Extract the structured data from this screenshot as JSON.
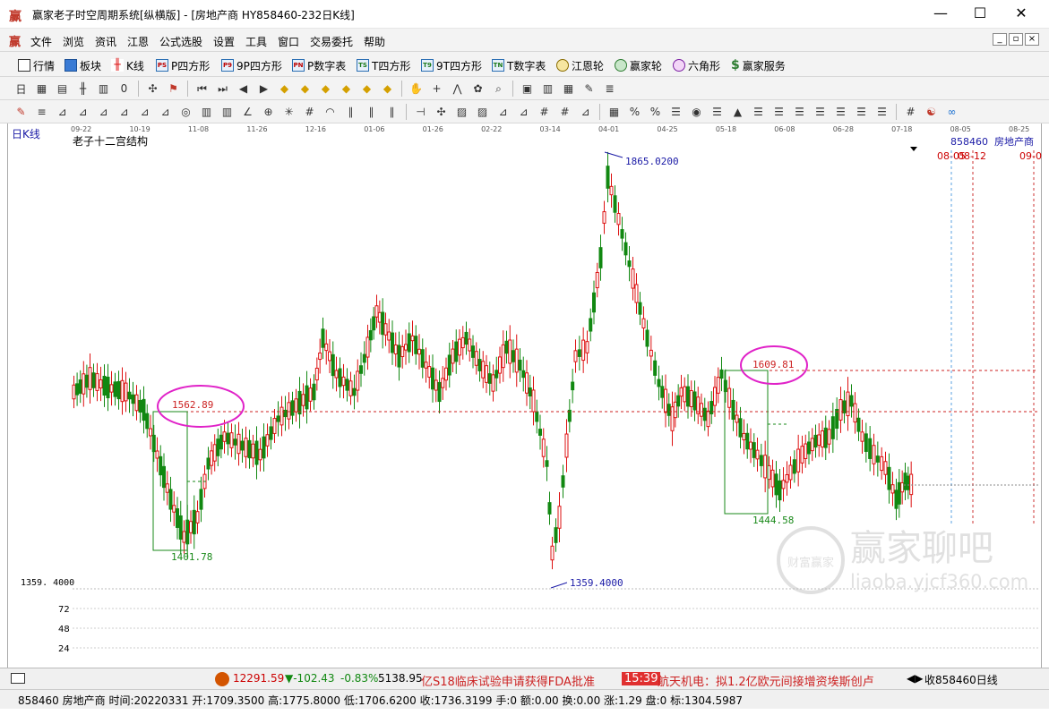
{
  "window": {
    "icon": "赢",
    "title": "赢家老子时空周期系统[纵横版] - [房地产商  HY858460-232日K线]",
    "minimize": "—",
    "maximize": "☐",
    "close": "✕"
  },
  "menu": {
    "items": [
      "文件",
      "浏览",
      "资讯",
      "江恩",
      "公式选股",
      "设置",
      "工具",
      "窗口",
      "交易委托",
      "帮助"
    ],
    "mdi": [
      "_",
      "▫",
      "×"
    ]
  },
  "toolbar1": {
    "items": [
      {
        "label": "行情",
        "icon": "grid-icon"
      },
      {
        "label": "板块",
        "icon": "blocks-icon"
      },
      {
        "label": "K线",
        "icon": "candles-icon"
      },
      {
        "label": "P四方形",
        "icon": "PS"
      },
      {
        "label": "9P四方形",
        "icon": "P9"
      },
      {
        "label": "P数字表",
        "icon": "PN"
      },
      {
        "label": "T四方形",
        "icon": "TS"
      },
      {
        "label": "9T四方形",
        "icon": "T9"
      },
      {
        "label": "T数字表",
        "icon": "TN"
      },
      {
        "label": "江恩轮",
        "icon": "wheel-icon"
      },
      {
        "label": "赢家轮",
        "icon": "wheel2-icon"
      },
      {
        "label": "六角形",
        "icon": "hexagon-icon"
      },
      {
        "label": "赢家服务",
        "icon": "dollar-icon"
      }
    ]
  },
  "toolbar2": {
    "icons": [
      "date-dropdown-icon",
      "table-icon",
      "doc-icon",
      "candles-icon",
      "kline-icon",
      "zero-dropdown-icon",
      "sep",
      "cross-icon",
      "flag-icon",
      "sep",
      "first-icon",
      "last-icon",
      "prev-icon",
      "next-icon",
      "diamond-icon",
      "diamond-icon",
      "diamond-icon",
      "diamond-icon",
      "diamond-icon",
      "diamond-icon",
      "sep",
      "hand-icon",
      "crosshair-icon",
      "trend-icon",
      "gift-icon",
      "zoom-icon",
      "sep",
      "calc-icon",
      "bars-icon",
      "calendar-icon",
      "clip-icon",
      "stack-icon"
    ]
  },
  "toolbar3": {
    "icons": [
      "pen-icon",
      "hlines-icon",
      "fan-icon",
      "fan-icon",
      "fan-icon",
      "fan-icon",
      "fan-icon",
      "fan-icon",
      "circle-icon",
      "bars-icon",
      "bars-icon",
      "angle-icon",
      "target-icon",
      "web-icon",
      "grid-icon",
      "arc-icon",
      "vlines-icon",
      "vlines-icon",
      "vlines-icon",
      "sep",
      "ruler-icon",
      "cross-icon",
      "square-icon",
      "square-icon",
      "fan-icon",
      "fan-icon",
      "grid-icon",
      "grid-icon",
      "fan-icon",
      "sep",
      "bar-chart-icon",
      "pct-icon",
      "percent-icon",
      "ladder-icon",
      "coin-icon",
      "ladder-icon",
      "chart-icon",
      "ladder-icon",
      "ladder-icon",
      "ladder-icon",
      "ladder-icon",
      "ladder-icon",
      "ladder-icon",
      "ladder-icon",
      "sep",
      "grid-icon",
      "yinyang-icon",
      "infinity-icon"
    ]
  },
  "chart": {
    "period_label": "日K线",
    "structure_label": "老子十二宫结构",
    "stock_code": "858460",
    "stock_name": "房地产商",
    "date_ticks": [
      "09-22",
      "10-19",
      "11-08",
      "11-26",
      "12-16",
      "01-06",
      "01-26",
      "02-22",
      "03-14",
      "04-01",
      "04-25",
      "05-18",
      "06-08",
      "06-28",
      "07-18",
      "08-05",
      "08-25"
    ],
    "future_dates": [
      "08-05",
      "08-12",
      "09-0"
    ],
    "annotations": {
      "high": "1865.0200",
      "low": "1359.4000",
      "circle_a": "1562.89",
      "circle_b": "1609.81",
      "low_a": "1401.78",
      "low_b": "1444.58",
      "axis_low": "1359. 4000"
    },
    "volume_ticks": [
      "72",
      "48",
      "24"
    ],
    "watermark": "赢家聊吧",
    "watermark_url": "liaoba.yjcf360.com",
    "watermark_badge": "财富赢家",
    "colors": {
      "up": "#dd1111",
      "down": "#118811",
      "annot": "#1a1aa6",
      "circle": "#e022c8"
    }
  },
  "status": {
    "index_value": "12291.59",
    "index_change": "▼-102.43",
    "index_pct": "-0.83%",
    "index_amount": "5138.95",
    "news1": "亿S18临床试验申请获得FDA批准",
    "time": "15:39",
    "news2": "航天机电：拟1.2亿欧元间接增资埃斯创卢",
    "right_label": "收858460日线"
  },
  "info": {
    "text": "858460 房地产商 时间:20220331 开:1709.3500 高:1775.8000 低:1706.6200 收:1736.3199 手:0 额:0.00 换:0.00 涨:1.29 盘:0 标:1304.5987"
  }
}
